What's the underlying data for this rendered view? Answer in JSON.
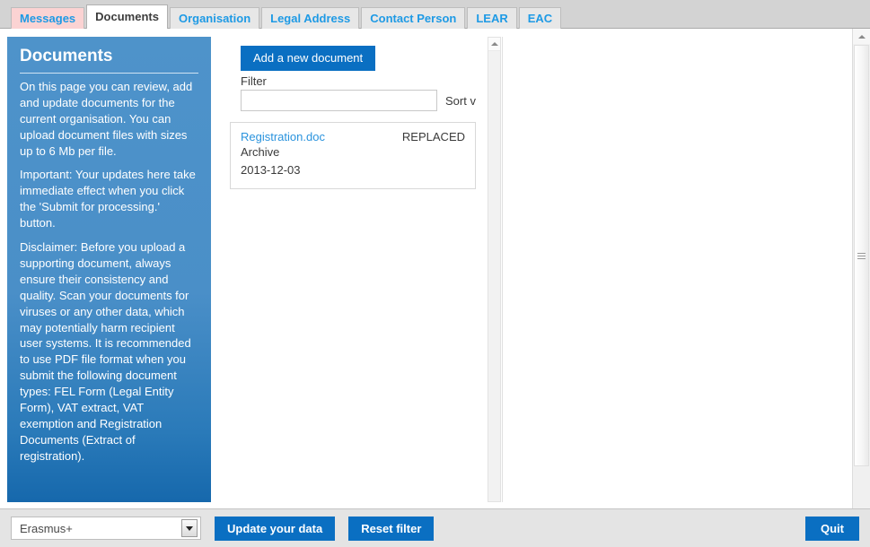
{
  "tabs": [
    {
      "label": "Messages",
      "state": "alert"
    },
    {
      "label": "Documents",
      "state": "active"
    },
    {
      "label": "Organisation",
      "state": "normal"
    },
    {
      "label": "Legal Address",
      "state": "normal"
    },
    {
      "label": "Contact Person",
      "state": "normal"
    },
    {
      "label": "LEAR",
      "state": "normal"
    },
    {
      "label": "EAC",
      "state": "normal"
    }
  ],
  "info_panel": {
    "title": "Documents",
    "paragraphs": [
      "On this page you can review, add and update documents for the current organisation. You can upload document files with sizes up to 6 Mb per file.",
      "Important: Your updates here take immediate effect when you click the 'Submit for processing.' button.",
      "Disclaimer: Before you upload a supporting document, always ensure their consistency and quality. Scan your documents for viruses or any other data, which may potentially harm recipient user systems. It is recommended to use PDF file format when you submit the following document types: FEL Form (Legal Entity Form), VAT extract, VAT exemption and Registration Documents (Extract of registration)."
    ]
  },
  "list_column": {
    "add_button_label": "Add a new document",
    "filter_label": "Filter",
    "filter_value": "",
    "filter_placeholder": "",
    "sort_label": "Sort v",
    "documents": [
      {
        "name": "Registration.doc",
        "status": "REPLACED",
        "type": "Archive",
        "date": "2013-12-03"
      }
    ]
  },
  "bottom_bar": {
    "programme_value": "Erasmus+",
    "update_label": "Update your data",
    "reset_label": "Reset filter",
    "quit_label": "Quit"
  },
  "colors": {
    "accent_blue": "#0a6fc2",
    "link_blue": "#2a93dd",
    "tab_blue": "#1e9ae5",
    "alert_tab_bg": "#fbd3d3",
    "panel_gradient_top": "#4e93ca",
    "panel_gradient_bottom": "#1668ac",
    "toolbar_bg": "#e4e4e4"
  }
}
